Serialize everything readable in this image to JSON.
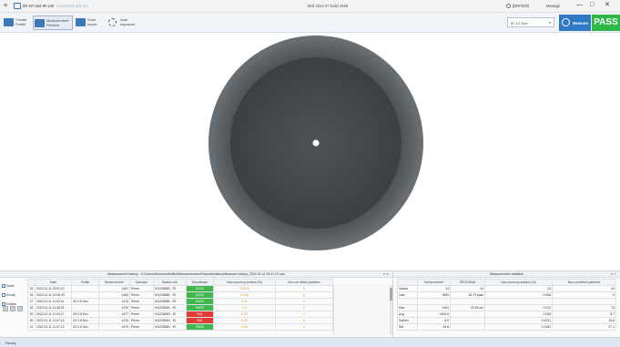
{
  "window": {
    "app_name": "ZK-NT and IR-140",
    "sub_name": "connected with pro",
    "center_title": "Bird 2022.07 build 1568",
    "menu_glyph": "≡",
    "right_label_1": "[DRIVER]",
    "right_label_2": "Manage",
    "minimize": "—",
    "maximize": "□",
    "close": "✕"
  },
  "toolbar": {
    "tools": [
      {
        "label_line1": "Create",
        "label_line2": "Profile",
        "icon": "create-profile-icon",
        "color": "#3a78b8"
      },
      {
        "label_line1": "Measurement",
        "label_line2": "Preview",
        "icon": "measurement-preview-icon",
        "color": "#3a78b8"
      },
      {
        "label_line1": "Scan",
        "label_line2": "report",
        "icon": "scan-report-icon",
        "color": "#3a78b8"
      },
      {
        "label_line1": "Auto",
        "label_line2": "exposure",
        "icon": "auto-exposure-icon",
        "color": "#555555"
      }
    ],
    "combo_value": "IR 1.0 Sec",
    "combo_arrow": "▾",
    "measure_label": "Measure",
    "pass_label": "PASS",
    "pass_color": "#2eb84a",
    "measure_color": "#2f78c3"
  },
  "history": {
    "title": "Measurement history - C:\\Users\\Documents\\Bird\\Measurements\\Reports\\history\\Measure history_2022.01.11 09.41.07.csv",
    "pin": "▾ ✕",
    "side_buttons": [
      "Save",
      "Email",
      "Delete"
    ],
    "columns": [
      "",
      "Date",
      "Profile",
      "Serial number",
      "Operator",
      "Station unit",
      "Result/data",
      "Non-recovery surface (%)",
      "Non-cal defect particles"
    ],
    "rows": [
      {
        "id": "25",
        "date": "2022.01.11 09:51:21",
        "profile": "",
        "serial": "1461",
        "operator": "Pierre",
        "station": "IH1228880 - IR",
        "result": "PASS",
        "status": "pass",
        "surface": "0.0079",
        "particles": "0"
      },
      {
        "id": "26",
        "date": "2022.01.11 10:09:40",
        "profile": "",
        "serial": "1466",
        "operator": "Pierre",
        "station": "IH1228880 - IR",
        "result": "PASS",
        "status": "pass",
        "surface": "0.016",
        "particles": "0"
      },
      {
        "id": "27",
        "date": "2022.01.11 11:03:21",
        "profile": "ZK 0.8 Sec",
        "serial": "1478",
        "operator": "Pierre",
        "station": "IH1228880 - IR",
        "result": "PASS",
        "status": "pass",
        "surface": "0.01",
        "particles": "0"
      },
      {
        "id": "28",
        "date": "2022.01.11 11:08:31",
        "profile": "",
        "serial": "1476",
        "operator": "Pierre",
        "station": "IH1228880 - IR",
        "result": "PASS",
        "status": "pass",
        "surface": "0.1",
        "particles": "0"
      },
      {
        "id": "29",
        "date": "2022.01.11 11:00:17",
        "profile": "ZK 0.8 Sec",
        "serial": "1477",
        "operator": "Pierre",
        "station": "IH1228880 - IR",
        "result": "FAIL",
        "status": "fail",
        "surface": "0.03",
        "particles": "0"
      },
      {
        "id": "30",
        "date": "2022.01.11 11:07:10",
        "profile": "ZK 0.8 Sec",
        "serial": "1476",
        "operator": "Pierre",
        "station": "IH1228880 - IR",
        "result": "FAIL",
        "status": "fail",
        "surface": "0.00",
        "particles": "0"
      },
      {
        "id": "31",
        "date": "2022.01.11 11:07:22",
        "profile": "ZK 0.8 Sec",
        "serial": "1479",
        "operator": "Pierre",
        "station": "IH1228880 - IR",
        "result": "PASS",
        "status": "pass",
        "surface": "0.00",
        "particles": "0"
      }
    ]
  },
  "statistics": {
    "title": "Measurement statistics",
    "pin": "▾ ✕",
    "columns": [
      "",
      "Serial number",
      "PROGRAM",
      "Non-recovery surface (%)",
      "Non-cal defect particles"
    ],
    "rows": [
      {
        "label": "Values",
        "c1": "24",
        "c2": "24",
        "c3": "24",
        "c4": "24"
      },
      {
        "label": "Last",
        "c1": "1850",
        "c2": "18.79 pass",
        "c3": "0.008",
        "c4": "0"
      },
      {
        "label": "",
        "c1": "",
        "c2": "",
        "c3": "",
        "c4": ""
      },
      {
        "label": "Max",
        "c1": "1481",
        "c2": "20.59 cm",
        "c3": "0.010",
        "c4": "73"
      },
      {
        "label": "Avg",
        "c1": "1460.6",
        "c2": "",
        "c3": "0.008",
        "c4": "8.7"
      },
      {
        "label": "StdDev",
        "c1": "8.9",
        "c2": "",
        "c3": "0.0031",
        "c4": "15.6"
      },
      {
        "label": "Std",
        "c1": "25.8",
        "c2": "",
        "c3": "0.0182",
        "c4": "27.1"
      }
    ]
  },
  "status": {
    "text": "Ready"
  }
}
